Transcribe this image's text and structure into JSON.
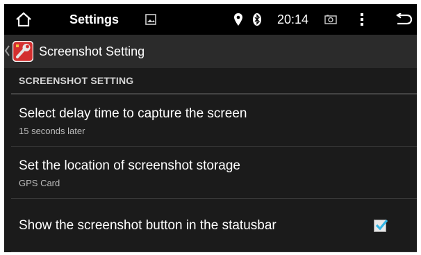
{
  "statusbar": {
    "title": "Settings",
    "time": "20:14",
    "icons": [
      "home-icon",
      "image-icon",
      "location-pin-icon",
      "bluetooth-icon",
      "screenshot-camera-icon",
      "overflow-menu-icon",
      "back-icon"
    ]
  },
  "actionbar": {
    "title": "Screenshot Setting",
    "icon": "wrench-settings-icon"
  },
  "section": {
    "header": "SCREENSHOT SETTING"
  },
  "preferences": [
    {
      "title": "Select delay time to capture the screen",
      "summary": "15 seconds later"
    },
    {
      "title": "Set the location of screenshot storage",
      "summary": "GPS Card"
    },
    {
      "title": "Show the screenshot button in the statusbar",
      "checked": true
    }
  ],
  "colors": {
    "accent": "#33b5e5",
    "icon_red": "#d32f2f"
  }
}
